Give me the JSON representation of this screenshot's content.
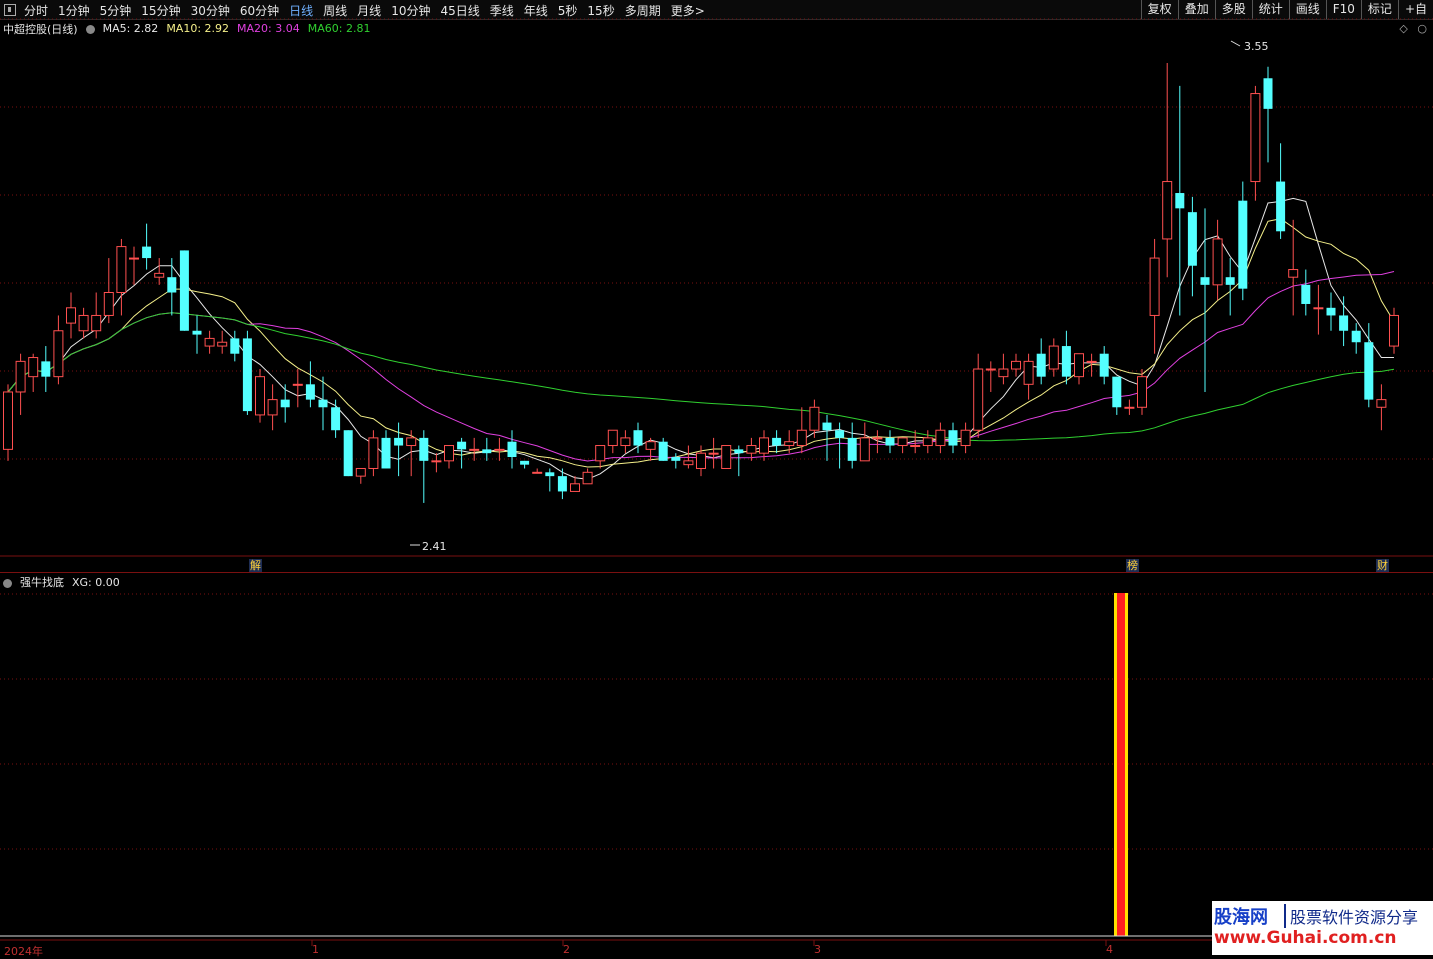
{
  "toolbar": {
    "periods": [
      "分时",
      "1分钟",
      "5分钟",
      "15分钟",
      "30分钟",
      "60分钟",
      "日线",
      "周线",
      "月线",
      "10分钟",
      "45日线",
      "季线",
      "年线",
      "5秒",
      "15秒",
      "多周期",
      "更多>"
    ],
    "active_period": "日线",
    "right_buttons": [
      "复权",
      "叠加",
      "多股",
      "统计",
      "画线",
      "F10",
      "标记",
      "+自"
    ]
  },
  "main": {
    "title": "中超控股(日线)",
    "ma5": "MA5: 2.82",
    "ma10": "MA10: 2.92",
    "ma20": "MA20: 3.04",
    "ma60": "MA60: 2.81",
    "high_label": "3.55",
    "low_label": "2.41",
    "markers": [
      "解",
      "榜",
      "财"
    ]
  },
  "indicator": {
    "name": "强牛找底",
    "value": "XG: 0.00"
  },
  "xaxis": {
    "labels": [
      "2024年",
      "1",
      "2",
      "3",
      "4"
    ]
  },
  "colors": {
    "up": "#ff5050",
    "down": "#54ffff",
    "ma5": "#e8e8e8",
    "ma10": "#f5f08a",
    "ma20": "#e040e0",
    "ma60": "#30d030",
    "grid": "#7a1010"
  },
  "watermark": {
    "brand": "股海网",
    "tagline": "股票软件资源分享",
    "url": "www.Guhai.com.cn"
  },
  "chart_data": {
    "type": "candlestick",
    "price_range": [
      2.3,
      3.62
    ],
    "candles": [
      {
        "o": 2.55,
        "h": 2.72,
        "l": 2.52,
        "c": 2.7
      },
      {
        "o": 2.7,
        "h": 2.8,
        "l": 2.64,
        "c": 2.78
      },
      {
        "o": 2.74,
        "h": 2.8,
        "l": 2.7,
        "c": 2.79
      },
      {
        "o": 2.78,
        "h": 2.82,
        "l": 2.7,
        "c": 2.74
      },
      {
        "o": 2.74,
        "h": 2.9,
        "l": 2.72,
        "c": 2.86
      },
      {
        "o": 2.88,
        "h": 2.96,
        "l": 2.84,
        "c": 2.92
      },
      {
        "o": 2.86,
        "h": 2.92,
        "l": 2.84,
        "c": 2.9
      },
      {
        "o": 2.86,
        "h": 2.96,
        "l": 2.84,
        "c": 2.9
      },
      {
        "o": 2.9,
        "h": 3.05,
        "l": 2.88,
        "c": 2.96
      },
      {
        "o": 2.96,
        "h": 3.1,
        "l": 2.9,
        "c": 3.08
      },
      {
        "o": 3.05,
        "h": 3.08,
        "l": 2.98,
        "c": 3.05
      },
      {
        "o": 3.08,
        "h": 3.14,
        "l": 3.02,
        "c": 3.05
      },
      {
        "o": 3.0,
        "h": 3.05,
        "l": 2.98,
        "c": 3.01
      },
      {
        "o": 3.0,
        "h": 3.05,
        "l": 2.9,
        "c": 2.96
      },
      {
        "o": 3.07,
        "h": 3.07,
        "l": 2.86,
        "c": 2.86
      },
      {
        "o": 2.86,
        "h": 2.9,
        "l": 2.8,
        "c": 2.85
      },
      {
        "o": 2.82,
        "h": 2.86,
        "l": 2.8,
        "c": 2.84
      },
      {
        "o": 2.82,
        "h": 2.86,
        "l": 2.8,
        "c": 2.83
      },
      {
        "o": 2.84,
        "h": 2.86,
        "l": 2.78,
        "c": 2.8
      },
      {
        "o": 2.84,
        "h": 2.86,
        "l": 2.64,
        "c": 2.65
      },
      {
        "o": 2.64,
        "h": 2.76,
        "l": 2.62,
        "c": 2.74
      },
      {
        "o": 2.64,
        "h": 2.72,
        "l": 2.6,
        "c": 2.68
      },
      {
        "o": 2.68,
        "h": 2.72,
        "l": 2.62,
        "c": 2.66
      },
      {
        "o": 2.72,
        "h": 2.76,
        "l": 2.66,
        "c": 2.72
      },
      {
        "o": 2.72,
        "h": 2.78,
        "l": 2.66,
        "c": 2.68
      },
      {
        "o": 2.68,
        "h": 2.74,
        "l": 2.6,
        "c": 2.66
      },
      {
        "o": 2.66,
        "h": 2.68,
        "l": 2.58,
        "c": 2.6
      },
      {
        "o": 2.6,
        "h": 2.6,
        "l": 2.48,
        "c": 2.48
      },
      {
        "o": 2.48,
        "h": 2.5,
        "l": 2.46,
        "c": 2.5
      },
      {
        "o": 2.5,
        "h": 2.6,
        "l": 2.48,
        "c": 2.58
      },
      {
        "o": 2.58,
        "h": 2.6,
        "l": 2.5,
        "c": 2.5
      },
      {
        "o": 2.58,
        "h": 2.62,
        "l": 2.48,
        "c": 2.56
      },
      {
        "o": 2.56,
        "h": 2.6,
        "l": 2.48,
        "c": 2.58
      },
      {
        "o": 2.58,
        "h": 2.6,
        "l": 2.41,
        "c": 2.52
      },
      {
        "o": 2.52,
        "h": 2.54,
        "l": 2.49,
        "c": 2.52
      },
      {
        "o": 2.52,
        "h": 2.56,
        "l": 2.5,
        "c": 2.56
      },
      {
        "o": 2.57,
        "h": 2.58,
        "l": 2.5,
        "c": 2.55
      },
      {
        "o": 2.55,
        "h": 2.58,
        "l": 2.52,
        "c": 2.55
      },
      {
        "o": 2.55,
        "h": 2.58,
        "l": 2.52,
        "c": 2.54
      },
      {
        "o": 2.55,
        "h": 2.58,
        "l": 2.52,
        "c": 2.55
      },
      {
        "o": 2.57,
        "h": 2.6,
        "l": 2.5,
        "c": 2.53
      },
      {
        "o": 2.52,
        "h": 2.52,
        "l": 2.5,
        "c": 2.51
      },
      {
        "o": 2.49,
        "h": 2.5,
        "l": 2.49,
        "c": 2.49
      },
      {
        "o": 2.49,
        "h": 2.5,
        "l": 2.44,
        "c": 2.48
      },
      {
        "o": 2.48,
        "h": 2.5,
        "l": 2.42,
        "c": 2.44
      },
      {
        "o": 2.44,
        "h": 2.48,
        "l": 2.44,
        "c": 2.46
      },
      {
        "o": 2.46,
        "h": 2.5,
        "l": 2.46,
        "c": 2.49
      },
      {
        "o": 2.52,
        "h": 2.56,
        "l": 2.5,
        "c": 2.56
      },
      {
        "o": 2.56,
        "h": 2.6,
        "l": 2.54,
        "c": 2.6
      },
      {
        "o": 2.56,
        "h": 2.6,
        "l": 2.54,
        "c": 2.58
      },
      {
        "o": 2.6,
        "h": 2.62,
        "l": 2.54,
        "c": 2.56
      },
      {
        "o": 2.55,
        "h": 2.58,
        "l": 2.52,
        "c": 2.57
      },
      {
        "o": 2.57,
        "h": 2.58,
        "l": 2.52,
        "c": 2.52
      },
      {
        "o": 2.53,
        "h": 2.54,
        "l": 2.5,
        "c": 2.52
      },
      {
        "o": 2.51,
        "h": 2.56,
        "l": 2.5,
        "c": 2.52
      },
      {
        "o": 2.5,
        "h": 2.56,
        "l": 2.48,
        "c": 2.54
      },
      {
        "o": 2.54,
        "h": 2.58,
        "l": 2.5,
        "c": 2.54
      },
      {
        "o": 2.5,
        "h": 2.56,
        "l": 2.5,
        "c": 2.56
      },
      {
        "o": 2.55,
        "h": 2.56,
        "l": 2.48,
        "c": 2.54
      },
      {
        "o": 2.54,
        "h": 2.58,
        "l": 2.52,
        "c": 2.56
      },
      {
        "o": 2.54,
        "h": 2.6,
        "l": 2.52,
        "c": 2.58
      },
      {
        "o": 2.58,
        "h": 2.6,
        "l": 2.54,
        "c": 2.56
      },
      {
        "o": 2.56,
        "h": 2.6,
        "l": 2.54,
        "c": 2.57
      },
      {
        "o": 2.56,
        "h": 2.66,
        "l": 2.54,
        "c": 2.6
      },
      {
        "o": 2.6,
        "h": 2.68,
        "l": 2.58,
        "c": 2.66
      },
      {
        "o": 2.62,
        "h": 2.64,
        "l": 2.52,
        "c": 2.6
      },
      {
        "o": 2.6,
        "h": 2.62,
        "l": 2.5,
        "c": 2.58
      },
      {
        "o": 2.58,
        "h": 2.62,
        "l": 2.5,
        "c": 2.52
      },
      {
        "o": 2.52,
        "h": 2.62,
        "l": 2.52,
        "c": 2.58
      },
      {
        "o": 2.58,
        "h": 2.6,
        "l": 2.54,
        "c": 2.58
      },
      {
        "o": 2.58,
        "h": 2.6,
        "l": 2.54,
        "c": 2.56
      },
      {
        "o": 2.56,
        "h": 2.58,
        "l": 2.54,
        "c": 2.58
      },
      {
        "o": 2.56,
        "h": 2.6,
        "l": 2.54,
        "c": 2.56
      },
      {
        "o": 2.56,
        "h": 2.6,
        "l": 2.54,
        "c": 2.58
      },
      {
        "o": 2.56,
        "h": 2.62,
        "l": 2.54,
        "c": 2.6
      },
      {
        "o": 2.6,
        "h": 2.62,
        "l": 2.54,
        "c": 2.56
      },
      {
        "o": 2.56,
        "h": 2.62,
        "l": 2.54,
        "c": 2.6
      },
      {
        "o": 2.6,
        "h": 2.8,
        "l": 2.58,
        "c": 2.76
      },
      {
        "o": 2.76,
        "h": 2.78,
        "l": 2.7,
        "c": 2.76
      },
      {
        "o": 2.74,
        "h": 2.8,
        "l": 2.72,
        "c": 2.76
      },
      {
        "o": 2.76,
        "h": 2.8,
        "l": 2.74,
        "c": 2.78
      },
      {
        "o": 2.72,
        "h": 2.8,
        "l": 2.68,
        "c": 2.78
      },
      {
        "o": 2.8,
        "h": 2.84,
        "l": 2.72,
        "c": 2.74
      },
      {
        "o": 2.76,
        "h": 2.84,
        "l": 2.74,
        "c": 2.82
      },
      {
        "o": 2.82,
        "h": 2.86,
        "l": 2.72,
        "c": 2.74
      },
      {
        "o": 2.74,
        "h": 2.8,
        "l": 2.72,
        "c": 2.8
      },
      {
        "o": 2.78,
        "h": 2.8,
        "l": 2.74,
        "c": 2.78
      },
      {
        "o": 2.8,
        "h": 2.82,
        "l": 2.72,
        "c": 2.74
      },
      {
        "o": 2.74,
        "h": 2.74,
        "l": 2.64,
        "c": 2.66
      },
      {
        "o": 2.66,
        "h": 2.68,
        "l": 2.64,
        "c": 2.66
      },
      {
        "o": 2.66,
        "h": 2.76,
        "l": 2.64,
        "c": 2.74
      },
      {
        "o": 2.9,
        "h": 3.1,
        "l": 2.8,
        "c": 3.05
      },
      {
        "o": 3.1,
        "h": 3.56,
        "l": 3.0,
        "c": 3.25
      },
      {
        "o": 3.22,
        "h": 3.5,
        "l": 2.9,
        "c": 3.18
      },
      {
        "o": 3.17,
        "h": 3.21,
        "l": 2.95,
        "c": 3.03
      },
      {
        "o": 3.0,
        "h": 3.18,
        "l": 2.7,
        "c": 2.98
      },
      {
        "o": 2.98,
        "h": 3.15,
        "l": 2.94,
        "c": 3.1
      },
      {
        "o": 3.0,
        "h": 3.05,
        "l": 2.9,
        "c": 2.98
      },
      {
        "o": 3.2,
        "h": 3.25,
        "l": 2.94,
        "c": 2.97
      },
      {
        "o": 3.25,
        "h": 3.5,
        "l": 3.2,
        "c": 3.48
      },
      {
        "o": 3.52,
        "h": 3.55,
        "l": 3.3,
        "c": 3.44
      },
      {
        "o": 3.25,
        "h": 3.35,
        "l": 3.1,
        "c": 3.12
      },
      {
        "o": 3.0,
        "h": 3.15,
        "l": 2.9,
        "c": 3.02
      },
      {
        "o": 2.98,
        "h": 3.02,
        "l": 2.9,
        "c": 2.93
      },
      {
        "o": 2.92,
        "h": 2.98,
        "l": 2.85,
        "c": 2.92
      },
      {
        "o": 2.92,
        "h": 2.96,
        "l": 2.86,
        "c": 2.9
      },
      {
        "o": 2.9,
        "h": 2.95,
        "l": 2.82,
        "c": 2.86
      },
      {
        "o": 2.86,
        "h": 2.88,
        "l": 2.8,
        "c": 2.83
      },
      {
        "o": 2.83,
        "h": 2.88,
        "l": 2.66,
        "c": 2.68
      },
      {
        "o": 2.66,
        "h": 2.72,
        "l": 2.6,
        "c": 2.68
      },
      {
        "o": 2.82,
        "h": 2.92,
        "l": 2.8,
        "c": 2.9
      }
    ],
    "signal": [
      {
        "bar_index": 92,
        "value": 1
      }
    ]
  }
}
